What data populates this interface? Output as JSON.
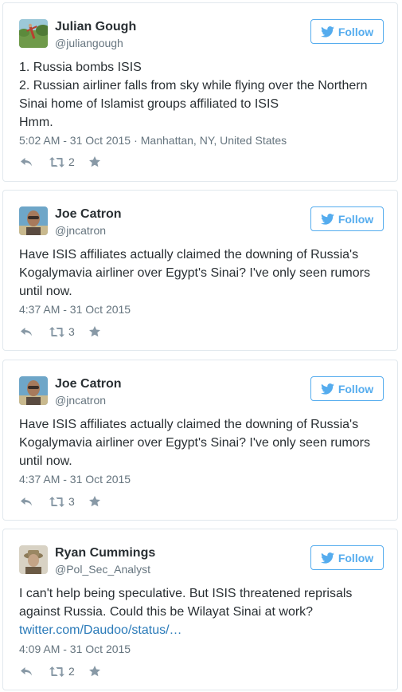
{
  "colors": {
    "accent": "#55acee",
    "link": "#2b7bb9",
    "muted": "#66757f",
    "icon": "#8899a6",
    "border": "#e1e8ed"
  },
  "tweets": [
    {
      "name": "Julian Gough",
      "handle": "@juliangough",
      "follow_label": "Follow",
      "lines": [
        "1. Russia bombs ISIS",
        "2. Russian airliner falls from sky while flying over the Northern",
        "Sinai home of Islamist groups affiliated to ISIS",
        "Hmm."
      ],
      "time": "5:02 AM - 31 Oct 2015",
      "separator": "·",
      "location": "Manhattan, NY, United States",
      "retweets": "2",
      "icons": [
        "reply-icon",
        "retweet-icon",
        "favorite-icon"
      ]
    },
    {
      "name": "Joe Catron",
      "handle": "@jncatron",
      "follow_label": "Follow",
      "lines": [
        "Have ISIS affiliates actually claimed the downing of Russia's",
        "Kogalymavia airliner over Egypt's Sinai? I've only seen rumors",
        "until now."
      ],
      "time": "4:37 AM - 31 Oct 2015",
      "retweets": "3",
      "icons": [
        "reply-icon",
        "retweet-icon",
        "favorite-icon"
      ]
    },
    {
      "name": "Joe Catron",
      "handle": "@jncatron",
      "follow_label": "Follow",
      "lines": [
        "Have ISIS affiliates actually claimed the downing of Russia's",
        "Kogalymavia airliner over Egypt's Sinai? I've only seen rumors",
        "until now."
      ],
      "time": "4:37 AM - 31 Oct 2015",
      "retweets": "3",
      "icons": [
        "reply-icon",
        "retweet-icon",
        "favorite-icon"
      ]
    },
    {
      "name": "Ryan Cummings",
      "handle": "@Pol_Sec_Analyst",
      "follow_label": "Follow",
      "lines": [
        "I can't help being speculative. But ISIS threatened reprisals",
        "against Russia. Could this be Wilayat Sinai at work?"
      ],
      "link": "twitter.com/Daudoo/status/…",
      "time": "4:09 AM - 31 Oct 2015",
      "retweets": "2",
      "icons": [
        "reply-icon",
        "retweet-icon",
        "favorite-icon"
      ]
    }
  ]
}
